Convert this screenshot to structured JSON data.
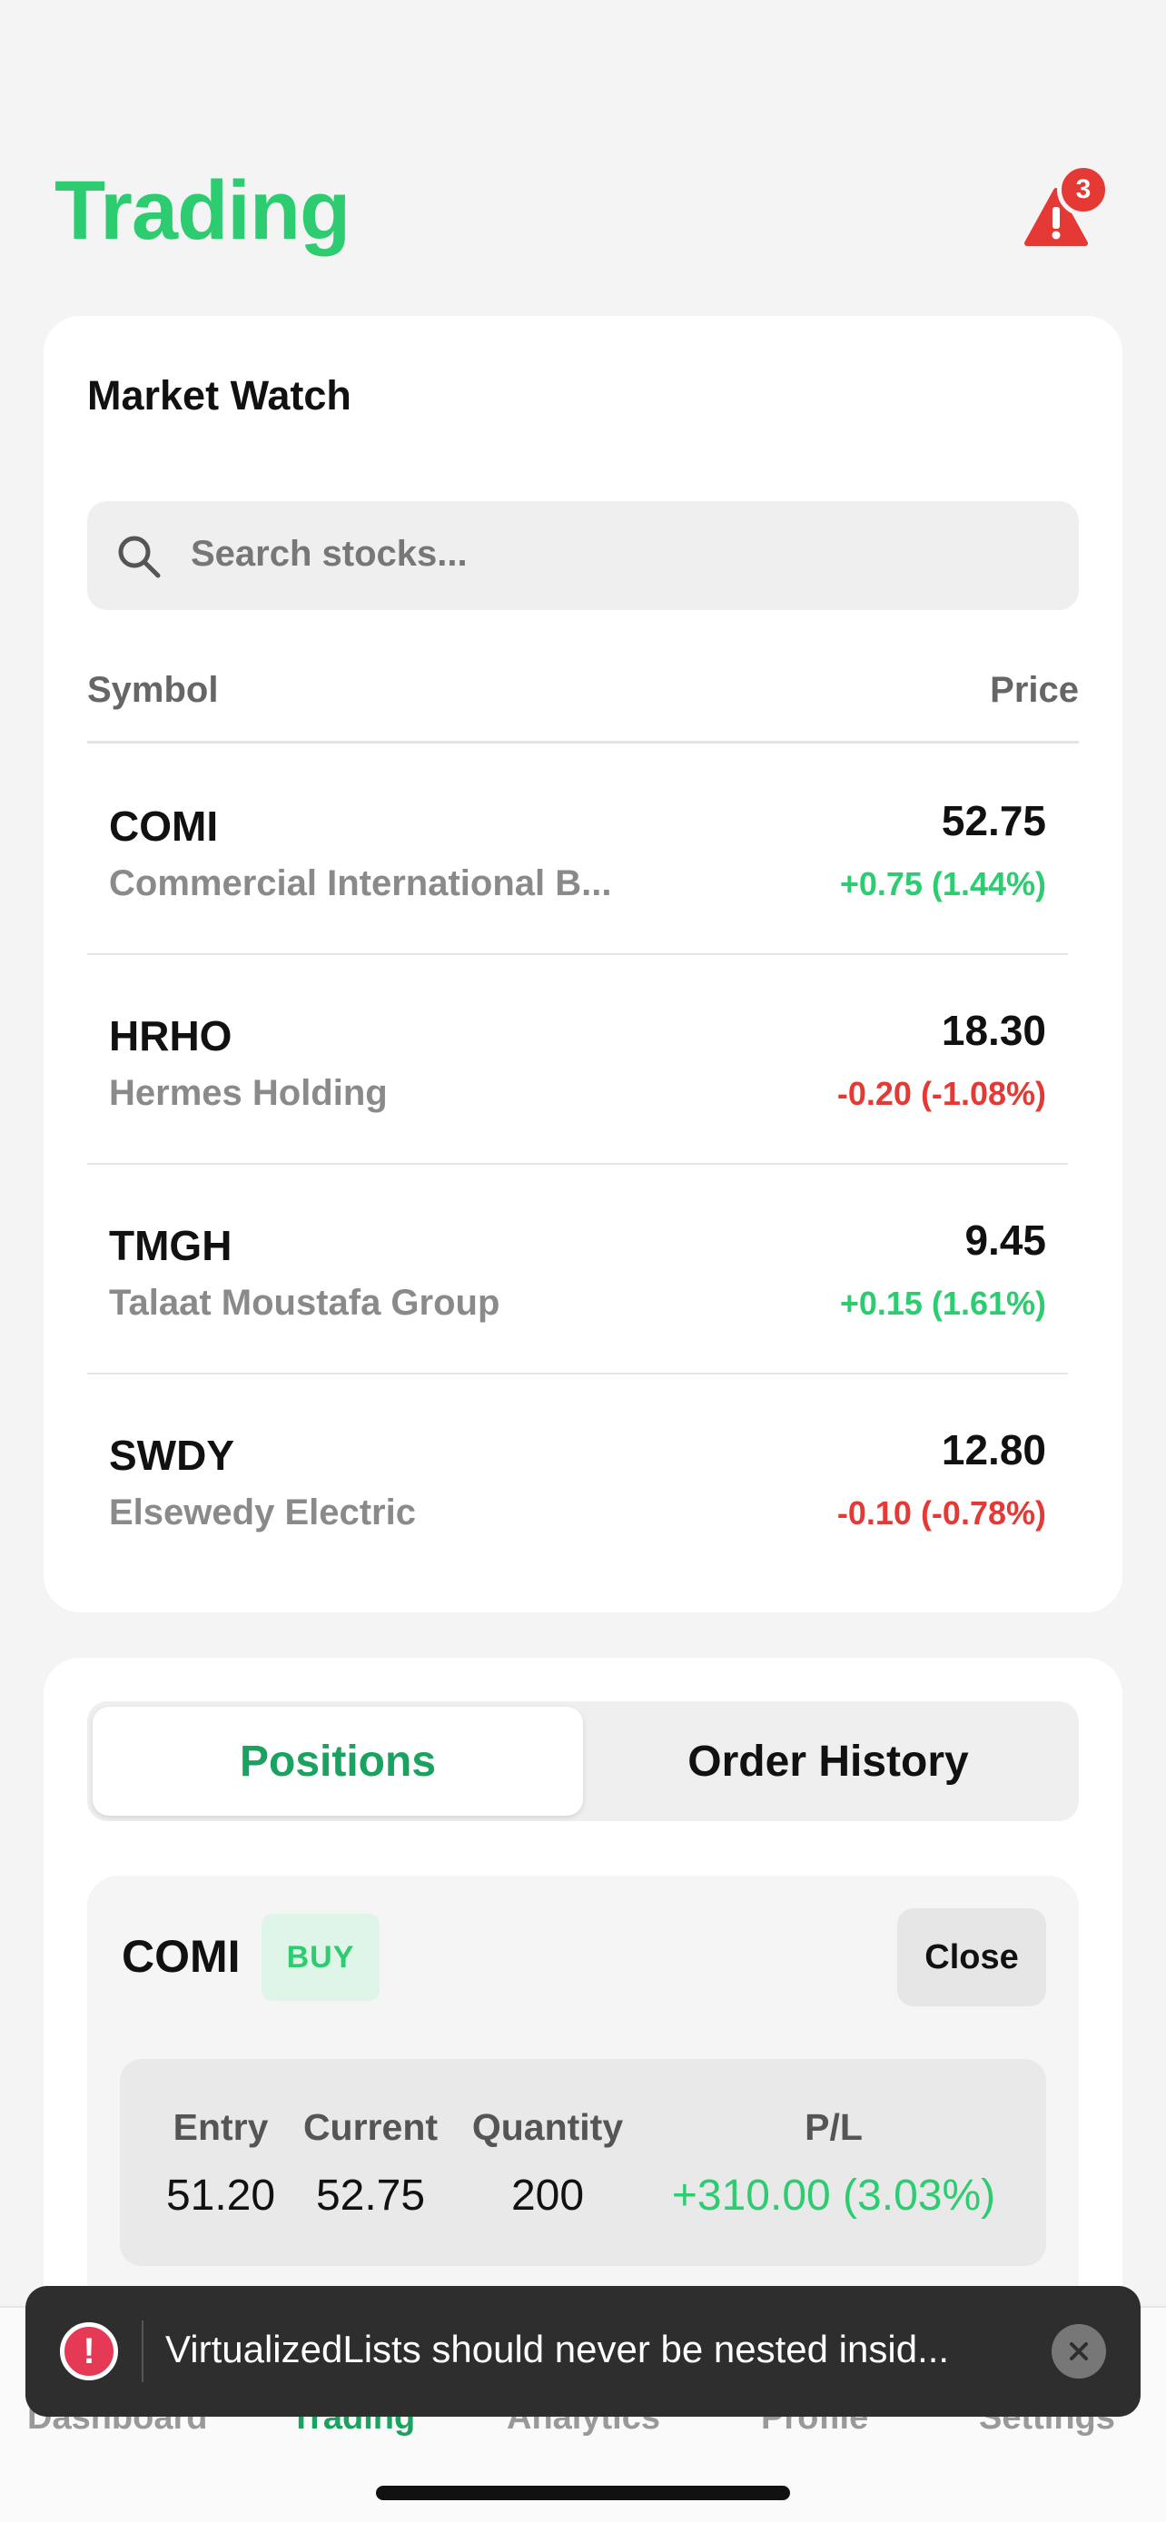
{
  "header": {
    "title": "Trading",
    "alert_count": "3"
  },
  "market_watch": {
    "title": "Market Watch",
    "search_placeholder": "Search stocks...",
    "col_symbol": "Symbol",
    "col_price": "Price",
    "rows": [
      {
        "symbol": "COMI",
        "name": "Commercial International B...",
        "price": "52.75",
        "change": "+0.75 (1.44%)",
        "direction": "up"
      },
      {
        "symbol": "HRHO",
        "name": "Hermes Holding",
        "price": "18.30",
        "change": "-0.20 (-1.08%)",
        "direction": "down"
      },
      {
        "symbol": "TMGH",
        "name": "Talaat Moustafa Group",
        "price": "9.45",
        "change": "+0.15 (1.61%)",
        "direction": "up"
      },
      {
        "symbol": "SWDY",
        "name": "Elsewedy Electric",
        "price": "12.80",
        "change": "-0.10 (-0.78%)",
        "direction": "down"
      }
    ]
  },
  "positions": {
    "tabs": [
      "Positions",
      "Order History"
    ],
    "active_tab": "Positions",
    "position": {
      "symbol": "COMI",
      "side": "BUY",
      "close_label": "Close",
      "entry_label": "Entry",
      "entry": "51.20",
      "current_label": "Current",
      "current": "52.75",
      "quantity_label": "Quantity",
      "quantity": "200",
      "pl_label": "P/L",
      "pl": "+310.00 (3.03%)"
    }
  },
  "tabbar": {
    "items": [
      "Dashboard",
      "Trading",
      "Analytics",
      "Profile",
      "Settings"
    ],
    "active": "Trading"
  },
  "toast": {
    "message": "VirtualizedLists should never be nested insid..."
  },
  "colors": {
    "accent": "#2ecc71",
    "positive": "#2ecc71",
    "negative": "#e53935"
  }
}
